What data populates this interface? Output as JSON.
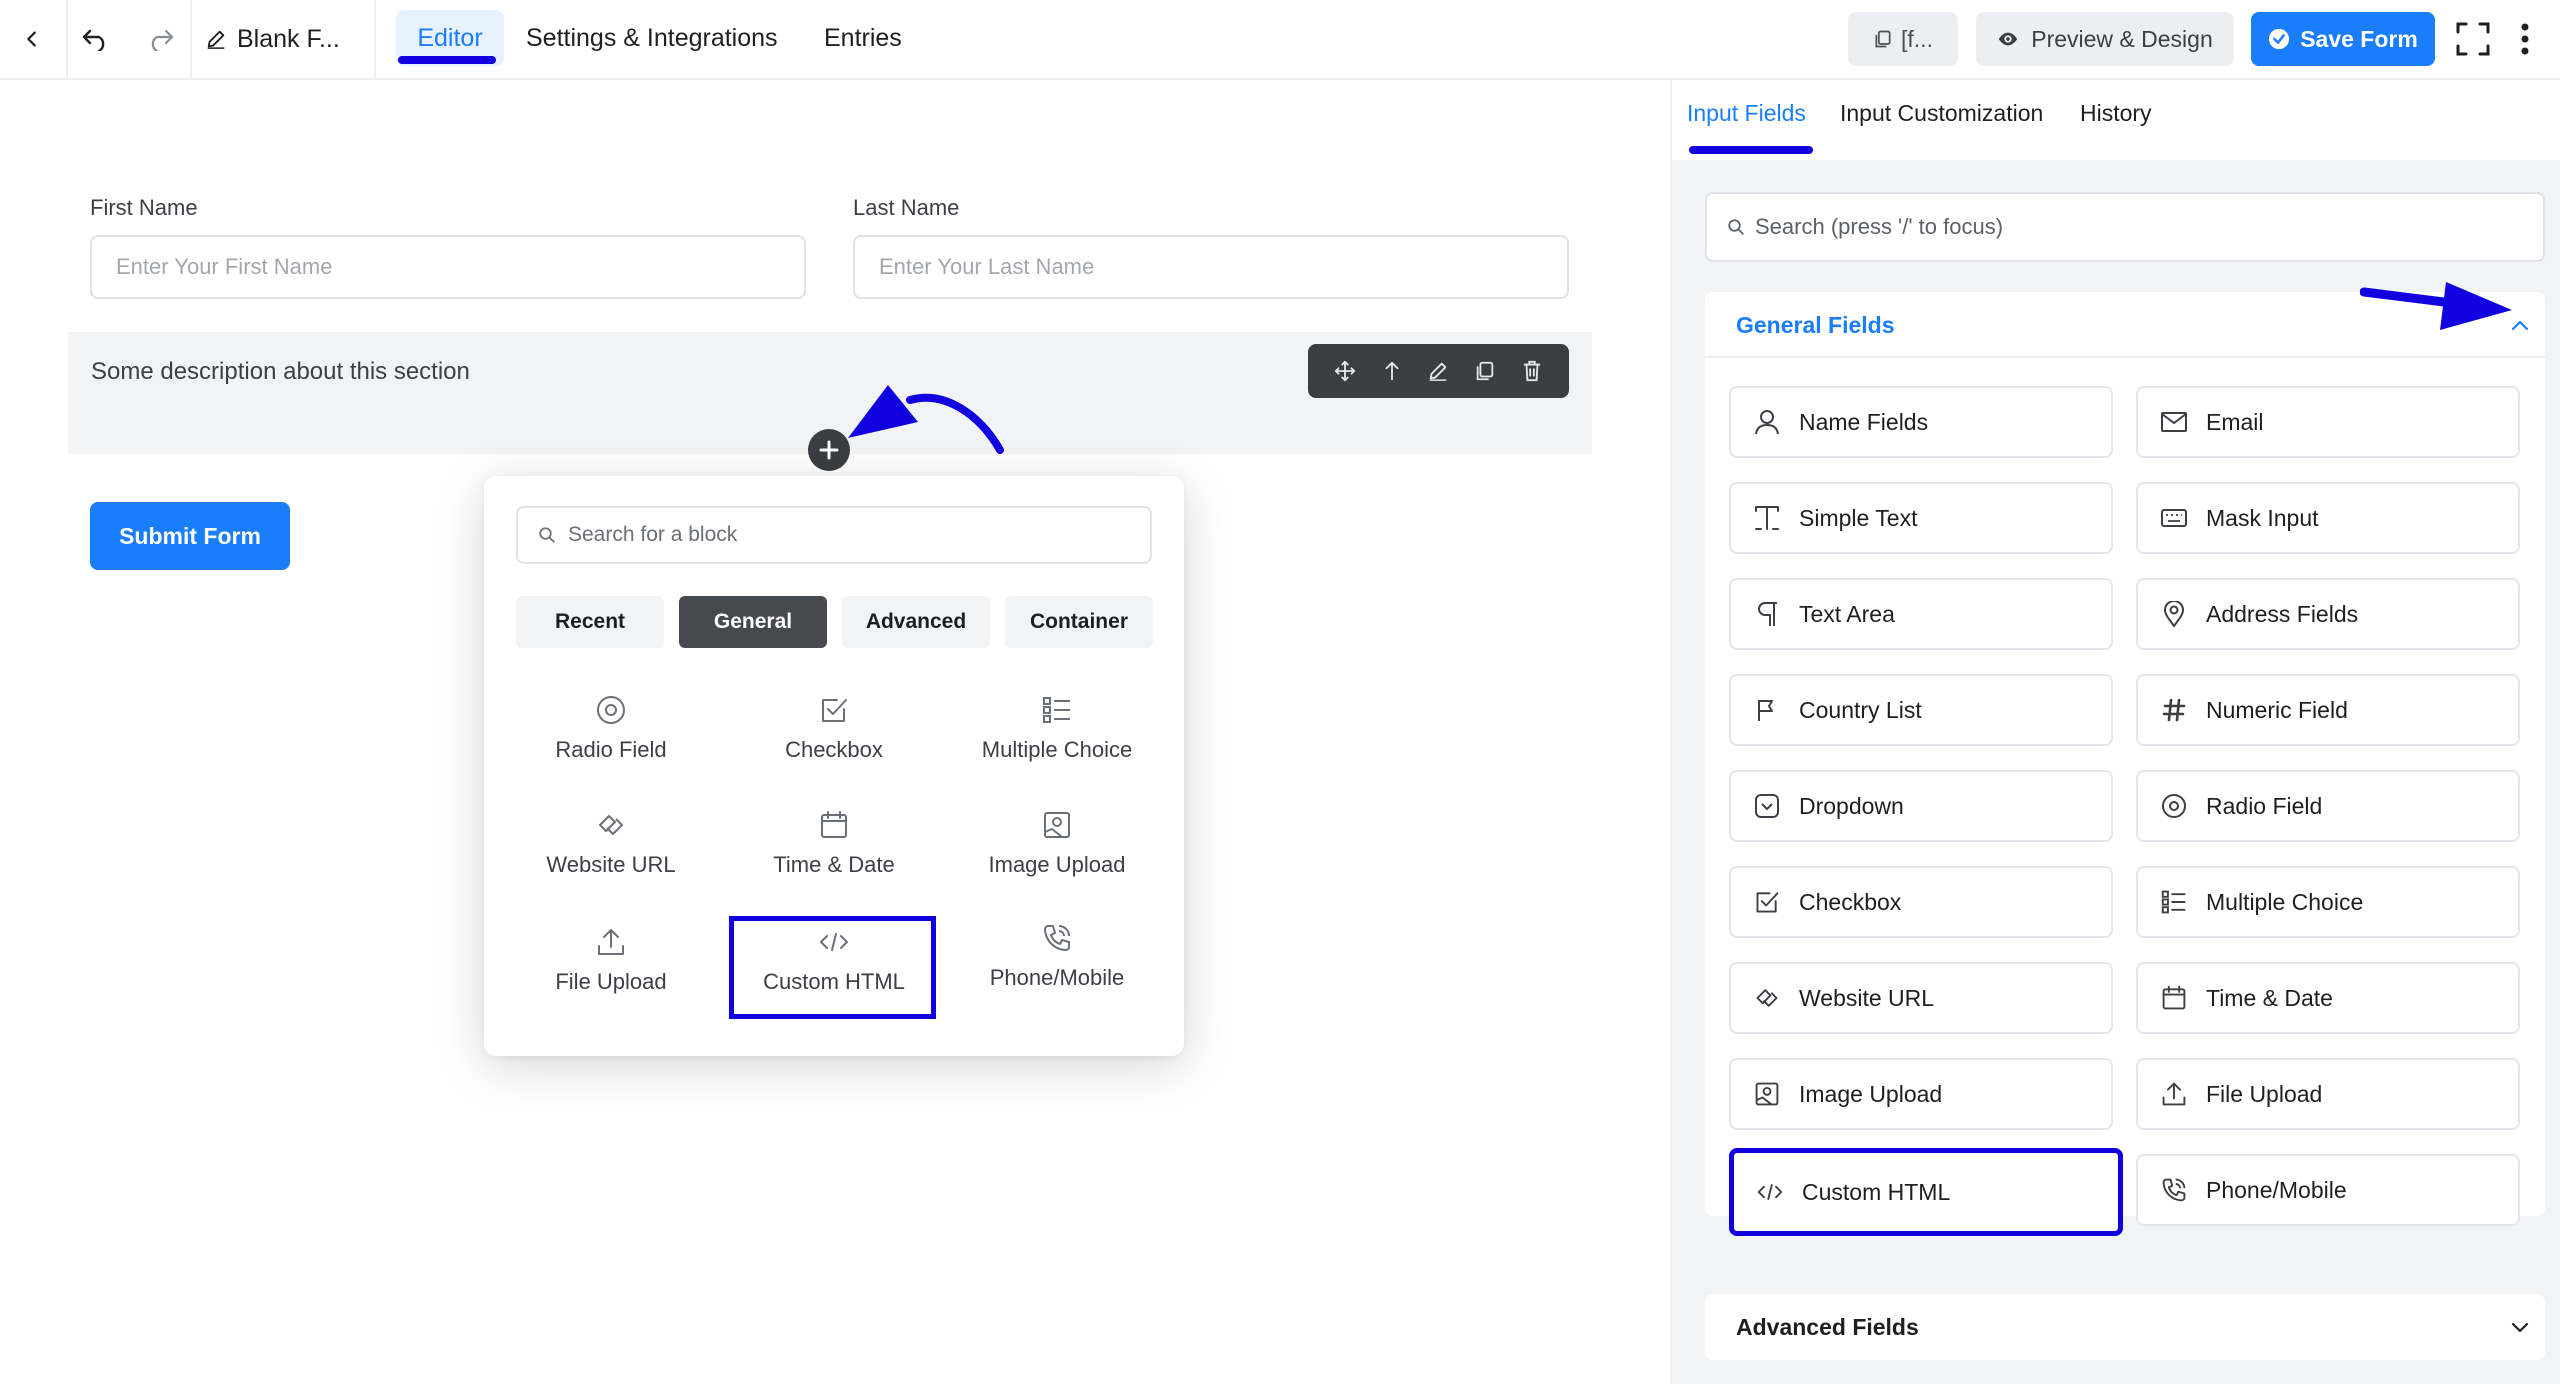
{
  "topbar": {
    "form_name": "Blank F...",
    "tabs": [
      "Editor",
      "Settings & Integrations",
      "Entries"
    ],
    "shortcode_label": "[f...",
    "preview_label": "Preview & Design",
    "save_label": "Save Form"
  },
  "form": {
    "first_name": {
      "label": "First Name",
      "placeholder": "Enter Your First Name"
    },
    "last_name": {
      "label": "Last Name",
      "placeholder": "Enter Your Last Name"
    },
    "section_description": "Some description about this section",
    "submit_label": "Submit Form"
  },
  "popover": {
    "search_placeholder": "Search for a block",
    "tabs": [
      "Recent",
      "General",
      "Advanced",
      "Container"
    ],
    "active_tab": "General",
    "items": [
      "Radio Field",
      "Checkbox",
      "Multiple Choice",
      "Website URL",
      "Time & Date",
      "Image Upload",
      "File Upload",
      "Custom HTML",
      "Phone/Mobile"
    ]
  },
  "right_panel": {
    "tabs": [
      "Input Fields",
      "Input Customization",
      "History"
    ],
    "active_tab": "Input Fields",
    "search_placeholder": "Search (press '/' to focus)",
    "general_fields_title": "General Fields",
    "fields": [
      {
        "label": "Name Fields",
        "icon": "user-icon"
      },
      {
        "label": "Email",
        "icon": "envelope-icon"
      },
      {
        "label": "Simple Text",
        "icon": "text-cursor-icon"
      },
      {
        "label": "Mask Input",
        "icon": "keyboard-icon"
      },
      {
        "label": "Text Area",
        "icon": "paragraph-icon"
      },
      {
        "label": "Address Fields",
        "icon": "map-pin-icon"
      },
      {
        "label": "Country List",
        "icon": "flag-icon"
      },
      {
        "label": "Numeric Field",
        "icon": "hash-icon"
      },
      {
        "label": "Dropdown",
        "icon": "dropdown-icon"
      },
      {
        "label": "Radio Field",
        "icon": "radio-icon"
      },
      {
        "label": "Checkbox",
        "icon": "checkbox-icon"
      },
      {
        "label": "Multiple Choice",
        "icon": "list-icon"
      },
      {
        "label": "Website URL",
        "icon": "link-icon"
      },
      {
        "label": "Time & Date",
        "icon": "calendar-icon"
      },
      {
        "label": "Image Upload",
        "icon": "image-icon"
      },
      {
        "label": "File Upload",
        "icon": "upload-icon"
      },
      {
        "label": "Custom HTML",
        "icon": "code-icon"
      },
      {
        "label": "Phone/Mobile",
        "icon": "phone-icon"
      }
    ],
    "advanced_fields_title": "Advanced Fields"
  },
  "colors": {
    "accent": "#1a7efb",
    "annotation": "#1100e0",
    "dark": "#3a3d42"
  }
}
